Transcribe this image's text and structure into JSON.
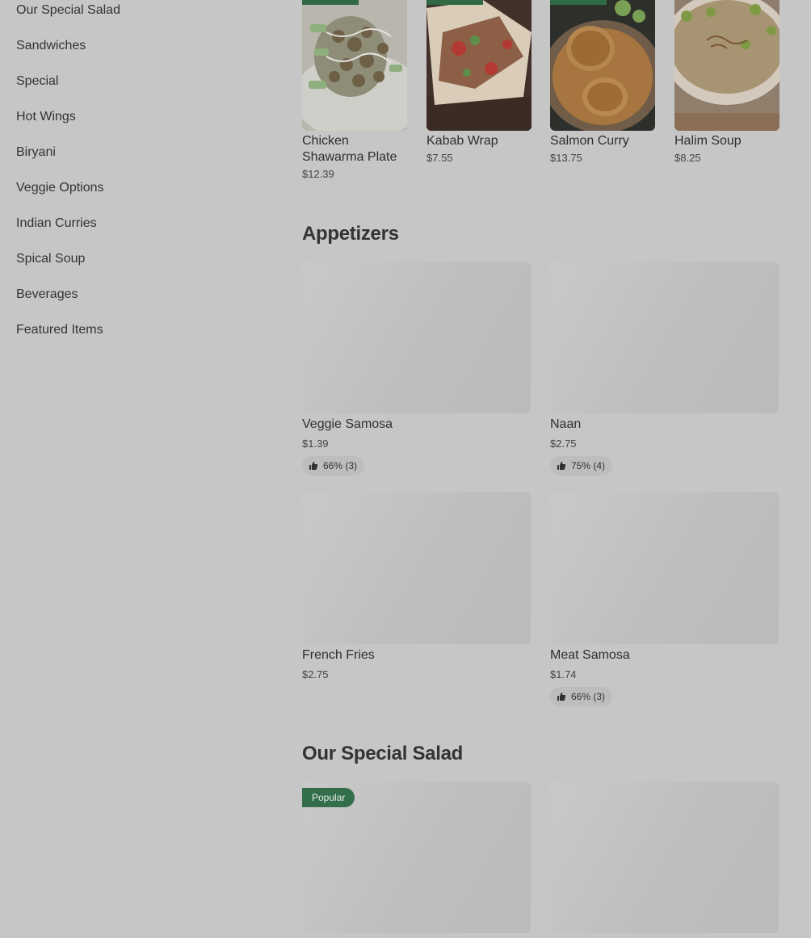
{
  "sidebar": {
    "items": [
      {
        "label": "Our Special Salad"
      },
      {
        "label": "Sandwiches"
      },
      {
        "label": "Special"
      },
      {
        "label": "Hot Wings"
      },
      {
        "label": "Biryani"
      },
      {
        "label": "Veggie Options"
      },
      {
        "label": "Indian Curries"
      },
      {
        "label": "Spical Soup"
      },
      {
        "label": "Beverages"
      },
      {
        "label": "Featured Items"
      }
    ]
  },
  "featured": {
    "items": [
      {
        "name": "Chicken Shawarma Plate",
        "price": "$12.39"
      },
      {
        "name": "Kabab Wrap",
        "price": "$7.55"
      },
      {
        "name": "Salmon Curry",
        "price": "$13.75"
      },
      {
        "name": "Halim Soup",
        "price": "$8.25"
      }
    ]
  },
  "appetizers": {
    "title": "Appetizers",
    "items": [
      {
        "name": "Veggie Samosa",
        "price": "$1.39",
        "rating": "66% (3)"
      },
      {
        "name": "Naan",
        "price": "$2.75",
        "rating": "75% (4)"
      },
      {
        "name": "French Fries",
        "price": "$2.75",
        "rating": ""
      },
      {
        "name": "Meat Samosa",
        "price": "$1.74",
        "rating": "66% (3)"
      }
    ]
  },
  "special_salad": {
    "title": "Our Special Salad",
    "badge": "Popular"
  },
  "colors": {
    "overlay_bg": "#c6c6c6",
    "accent_green": "#336e4a"
  }
}
